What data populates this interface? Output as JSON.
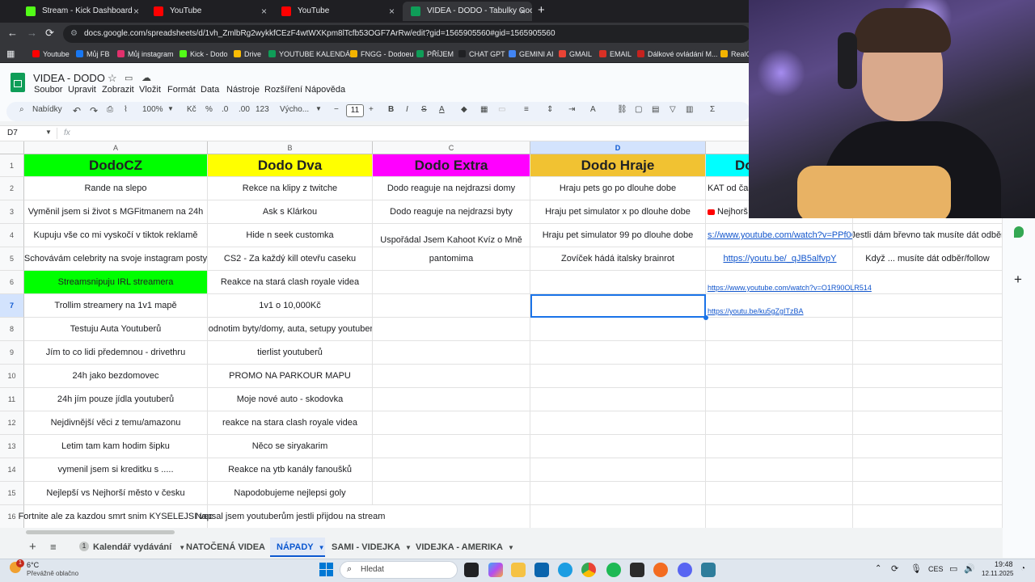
{
  "browser": {
    "tabs": [
      {
        "title": "Stream - Kick Dashboard",
        "color": "#53fc18"
      },
      {
        "title": "YouTube",
        "color": "#ff0000"
      },
      {
        "title": "YouTube",
        "color": "#ff0000"
      },
      {
        "title": "VIDEA - DODO - Tabulky Googl",
        "color": "#0f9d58"
      }
    ],
    "url": "docs.google.com/spreadsheets/d/1vh_ZmlbRg2wykkfCEzF4wtWXKpm8lTcfb53OGF7ArRw/edit?gid=1565905560#gid=1565905560",
    "bookmarks": [
      {
        "label": "Youtube",
        "color": "#ff0000"
      },
      {
        "label": "Můj FB",
        "color": "#1877f2"
      },
      {
        "label": "Můj instagram",
        "color": "#e1306c"
      },
      {
        "label": "Kick - Dodo",
        "color": "#53fc18"
      },
      {
        "label": "Drive",
        "color": "#fbbc04"
      },
      {
        "label": "YOUTUBE KALENDÁŘ",
        "color": "#0f9d58"
      },
      {
        "label": "FNGG - Dodoeu",
        "color": "#f4b400"
      },
      {
        "label": "PŘÍJEM",
        "color": "#0f9d58"
      },
      {
        "label": "CHAT GPT",
        "color": "#202124"
      },
      {
        "label": "GEMINI AI",
        "color": "#4285f4"
      },
      {
        "label": "GMAIL",
        "color": "#ea4335"
      },
      {
        "label": "EMAIL",
        "color": "#d93025"
      },
      {
        "label": "Dálkové ovládání M...",
        "color": "#c5221f"
      },
      {
        "label": "RealG",
        "color": "#f4b400"
      }
    ]
  },
  "doc": {
    "title": "VIDEA - DODO",
    "menu": [
      "Soubor",
      "Upravit",
      "Zobrazit",
      "Vložit",
      "Formát",
      "Data",
      "Nástroje",
      "Rozšíření",
      "Nápověda"
    ],
    "toolbar": {
      "search": "Nabídky",
      "zoom": "100%",
      "currency": "Kč",
      "percent": "%",
      "dec_less": ".0",
      "dec_more": ".00",
      "num": "123",
      "font": "Výcho...",
      "size": "11",
      "bold": "B",
      "italic": "I",
      "sum": "Σ"
    },
    "namebox": "D7",
    "fx": "fx"
  },
  "grid": {
    "columns": [
      "A",
      "B",
      "C",
      "D",
      ""
    ],
    "headers": [
      "DodoCZ",
      "Dodo Dva",
      "Dodo Extra",
      "Dodo Hraje",
      "Do"
    ],
    "header_colors": [
      "#00ff00",
      "#ffff00",
      "#ff00ff",
      "#f1c232",
      "#00ffff"
    ],
    "rows": [
      [
        "Rande na slepo",
        "Rekce na klipy z twitche",
        "Dodo reaguje na nejdrazsi domy",
        "Hraju pets go po dlouhe dobe",
        "KAT od času",
        ""
      ],
      [
        "Vyměnil jsem si život s MGFitmanem na 24h",
        "Ask s Klárkou",
        "Dodo reaguje na nejdrazsi byty",
        "Hraju pet simulator x po dlouhe dobe",
        "Nejhorš",
        ""
      ],
      [
        "Kupuju vše co mi vyskočí v tiktok reklamě",
        "Hide n seek customka",
        "Uspořádal Jsem Kahoot Kvíz o Mně",
        "Hraju pet simulator 99 po dlouhe dobe",
        "s://www.youtube.com/watch?v=PPf0Qz1K",
        "Jestli dám břevno tak musíte dát odběr"
      ],
      [
        "Schovávám celebrity na svoje instagram posty",
        "CS2 - Za každý kill otevřu caseku",
        "pantomima",
        "Zovíček hádá italsky brainrot",
        "https://youtu.be/_qJB5alfvpY",
        "Když ... musíte dát odběr/follow"
      ],
      [
        "Streamsnipuju IRL streamera",
        "Reakce na stará clash royale videa",
        "",
        "",
        "https://www.youtube.com/watch?v=O1R90OLR514",
        ""
      ],
      [
        "Trollim streamery na 1v1 mapě",
        "1v1 o 10,000Kč",
        "",
        "",
        "https://youtu.be/ku5gZgITzBA",
        ""
      ],
      [
        "Testuju Auta Youtuberů",
        "Hodnotim byty/domy, auta, setupy youtuberů",
        "",
        "",
        "",
        ""
      ],
      [
        "Jím to co lidi předemnou - drivethru",
        "tierlist youtuberů",
        "",
        "",
        "",
        ""
      ],
      [
        "24h jako bezdomovec",
        "PROMO NA PARKOUR MAPU",
        "",
        "",
        "",
        ""
      ],
      [
        "24h jím pouze jídla youtuberů",
        "Moje nové auto - skodovka",
        "",
        "",
        "",
        ""
      ],
      [
        "Nejdivnější věci z temu/amazonu",
        "reakce na stara clash royale videa",
        "",
        "",
        "",
        ""
      ],
      [
        "Letim tam kam hodim šipku",
        "Něco se siryakarim",
        "",
        "",
        "",
        ""
      ],
      [
        "vymenil jsem si kreditku s .....",
        "Reakce na ytb kanály fanoušků",
        "",
        "",
        "",
        ""
      ],
      [
        "Nejlepší vs Nejhorší město v česku",
        "Napodobujeme nejlepsi goly",
        "",
        "",
        "",
        ""
      ],
      [
        "Fortnite ale za kazdou smrt snim KYSELEJSI vec",
        "Napsal jsem youtuberům jestli přijdou na stream",
        "",
        "",
        "",
        ""
      ]
    ],
    "row_numbers": [
      "1",
      "2",
      "3",
      "4",
      "5",
      "6",
      "7",
      "8",
      "9",
      "10",
      "11",
      "12",
      "13",
      "14",
      "15",
      "16"
    ]
  },
  "sheets": {
    "tabs": [
      "Kalendář vydávání",
      "NATOČENÁ VIDEA",
      "NÁPADY",
      "SAMI - VIDEJKA",
      "VIDEJKA - AMERIKA"
    ],
    "badge": "1",
    "active": "NÁPADY"
  },
  "taskbar": {
    "weather_temp": "6°C",
    "weather_desc": "Převážně oblačno",
    "search": "Hledat",
    "lang": "CES",
    "time": "19:48",
    "date": "12.11.2025",
    "notif": "1"
  }
}
